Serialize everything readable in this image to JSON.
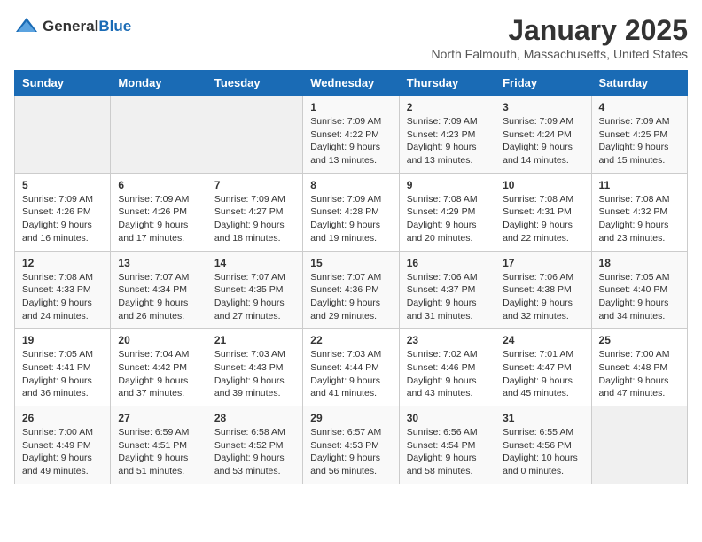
{
  "header": {
    "logo_general": "General",
    "logo_blue": "Blue",
    "title": "January 2025",
    "subtitle": "North Falmouth, Massachusetts, United States"
  },
  "weekdays": [
    "Sunday",
    "Monday",
    "Tuesday",
    "Wednesday",
    "Thursday",
    "Friday",
    "Saturday"
  ],
  "weeks": [
    [
      {
        "day": "",
        "empty": true
      },
      {
        "day": "",
        "empty": true
      },
      {
        "day": "",
        "empty": true
      },
      {
        "day": "1",
        "sunrise": "7:09 AM",
        "sunset": "4:22 PM",
        "daylight": "9 hours and 13 minutes."
      },
      {
        "day": "2",
        "sunrise": "7:09 AM",
        "sunset": "4:23 PM",
        "daylight": "9 hours and 13 minutes."
      },
      {
        "day": "3",
        "sunrise": "7:09 AM",
        "sunset": "4:24 PM",
        "daylight": "9 hours and 14 minutes."
      },
      {
        "day": "4",
        "sunrise": "7:09 AM",
        "sunset": "4:25 PM",
        "daylight": "9 hours and 15 minutes."
      }
    ],
    [
      {
        "day": "5",
        "sunrise": "7:09 AM",
        "sunset": "4:26 PM",
        "daylight": "9 hours and 16 minutes."
      },
      {
        "day": "6",
        "sunrise": "7:09 AM",
        "sunset": "4:26 PM",
        "daylight": "9 hours and 17 minutes."
      },
      {
        "day": "7",
        "sunrise": "7:09 AM",
        "sunset": "4:27 PM",
        "daylight": "9 hours and 18 minutes."
      },
      {
        "day": "8",
        "sunrise": "7:09 AM",
        "sunset": "4:28 PM",
        "daylight": "9 hours and 19 minutes."
      },
      {
        "day": "9",
        "sunrise": "7:08 AM",
        "sunset": "4:29 PM",
        "daylight": "9 hours and 20 minutes."
      },
      {
        "day": "10",
        "sunrise": "7:08 AM",
        "sunset": "4:31 PM",
        "daylight": "9 hours and 22 minutes."
      },
      {
        "day": "11",
        "sunrise": "7:08 AM",
        "sunset": "4:32 PM",
        "daylight": "9 hours and 23 minutes."
      }
    ],
    [
      {
        "day": "12",
        "sunrise": "7:08 AM",
        "sunset": "4:33 PM",
        "daylight": "9 hours and 24 minutes."
      },
      {
        "day": "13",
        "sunrise": "7:07 AM",
        "sunset": "4:34 PM",
        "daylight": "9 hours and 26 minutes."
      },
      {
        "day": "14",
        "sunrise": "7:07 AM",
        "sunset": "4:35 PM",
        "daylight": "9 hours and 27 minutes."
      },
      {
        "day": "15",
        "sunrise": "7:07 AM",
        "sunset": "4:36 PM",
        "daylight": "9 hours and 29 minutes."
      },
      {
        "day": "16",
        "sunrise": "7:06 AM",
        "sunset": "4:37 PM",
        "daylight": "9 hours and 31 minutes."
      },
      {
        "day": "17",
        "sunrise": "7:06 AM",
        "sunset": "4:38 PM",
        "daylight": "9 hours and 32 minutes."
      },
      {
        "day": "18",
        "sunrise": "7:05 AM",
        "sunset": "4:40 PM",
        "daylight": "9 hours and 34 minutes."
      }
    ],
    [
      {
        "day": "19",
        "sunrise": "7:05 AM",
        "sunset": "4:41 PM",
        "daylight": "9 hours and 36 minutes."
      },
      {
        "day": "20",
        "sunrise": "7:04 AM",
        "sunset": "4:42 PM",
        "daylight": "9 hours and 37 minutes."
      },
      {
        "day": "21",
        "sunrise": "7:03 AM",
        "sunset": "4:43 PM",
        "daylight": "9 hours and 39 minutes."
      },
      {
        "day": "22",
        "sunrise": "7:03 AM",
        "sunset": "4:44 PM",
        "daylight": "9 hours and 41 minutes."
      },
      {
        "day": "23",
        "sunrise": "7:02 AM",
        "sunset": "4:46 PM",
        "daylight": "9 hours and 43 minutes."
      },
      {
        "day": "24",
        "sunrise": "7:01 AM",
        "sunset": "4:47 PM",
        "daylight": "9 hours and 45 minutes."
      },
      {
        "day": "25",
        "sunrise": "7:00 AM",
        "sunset": "4:48 PM",
        "daylight": "9 hours and 47 minutes."
      }
    ],
    [
      {
        "day": "26",
        "sunrise": "7:00 AM",
        "sunset": "4:49 PM",
        "daylight": "9 hours and 49 minutes."
      },
      {
        "day": "27",
        "sunrise": "6:59 AM",
        "sunset": "4:51 PM",
        "daylight": "9 hours and 51 minutes."
      },
      {
        "day": "28",
        "sunrise": "6:58 AM",
        "sunset": "4:52 PM",
        "daylight": "9 hours and 53 minutes."
      },
      {
        "day": "29",
        "sunrise": "6:57 AM",
        "sunset": "4:53 PM",
        "daylight": "9 hours and 56 minutes."
      },
      {
        "day": "30",
        "sunrise": "6:56 AM",
        "sunset": "4:54 PM",
        "daylight": "9 hours and 58 minutes."
      },
      {
        "day": "31",
        "sunrise": "6:55 AM",
        "sunset": "4:56 PM",
        "daylight": "10 hours and 0 minutes."
      },
      {
        "day": "",
        "empty": true
      }
    ]
  ]
}
